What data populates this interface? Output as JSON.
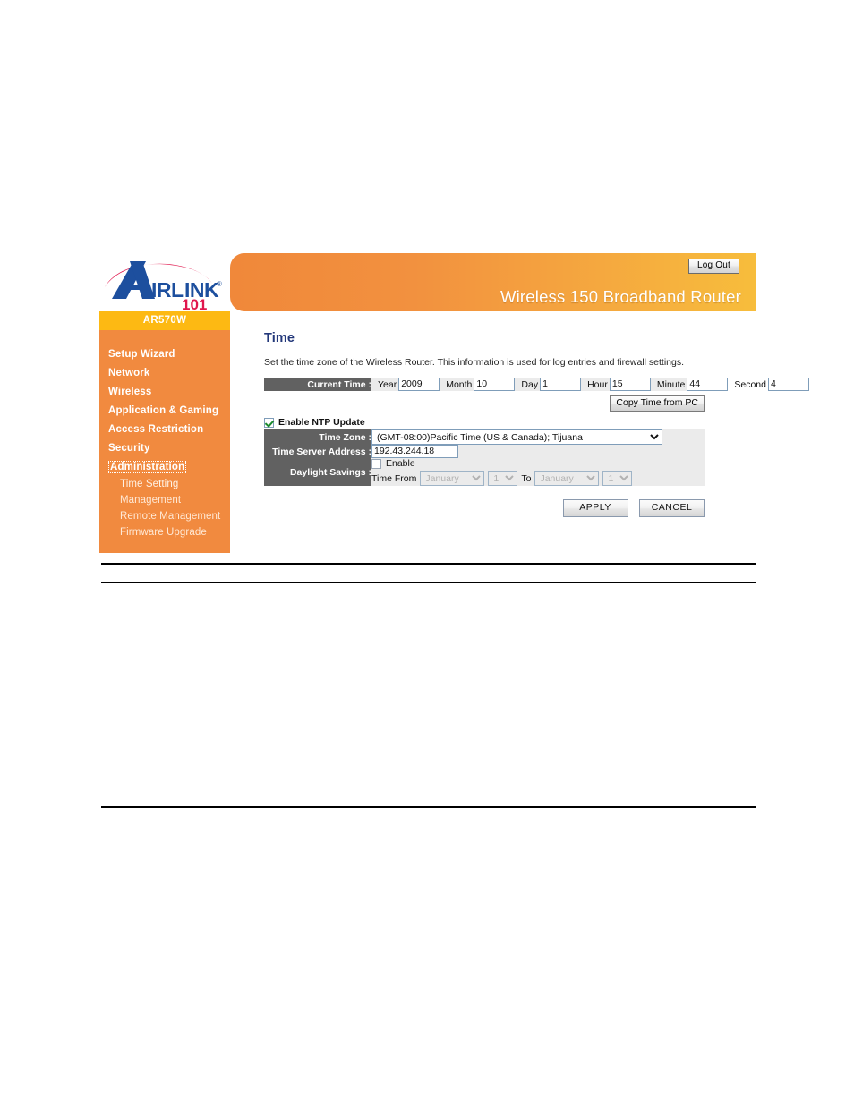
{
  "header": {
    "logo_text": "AIRLINK",
    "logo_sub": "101",
    "logo_reg": "®",
    "logout_label": "Log Out",
    "title": "Wireless 150 Broadband Router"
  },
  "sidebar": {
    "model": "AR570W",
    "items": [
      {
        "label": "Setup Wizard",
        "focused": false
      },
      {
        "label": "Network",
        "focused": false
      },
      {
        "label": "Wireless",
        "focused": false
      },
      {
        "label": "Application & Gaming",
        "focused": false
      },
      {
        "label": "Access Restriction",
        "focused": false
      },
      {
        "label": "Security",
        "focused": false
      },
      {
        "label": "Administration",
        "focused": true
      }
    ],
    "subitems": [
      {
        "label": "Time Setting",
        "active": true
      },
      {
        "label": "Management",
        "active": false
      },
      {
        "label": "Remote Management",
        "active": false
      },
      {
        "label": "Firmware Upgrade",
        "active": false
      }
    ]
  },
  "main": {
    "title": "Time",
    "description": "Set the time zone of the Wireless Router. This information is used for log entries and firewall settings.",
    "current_time": {
      "label": "Current Time :",
      "fields": [
        {
          "name": "Year",
          "value": "2009"
        },
        {
          "name": "Month",
          "value": "10"
        },
        {
          "name": "Day",
          "value": "1"
        },
        {
          "name": "Hour",
          "value": "15"
        },
        {
          "name": "Minute",
          "value": "44"
        },
        {
          "name": "Second",
          "value": "4"
        }
      ],
      "copy_button": "Copy Time from PC"
    },
    "ntp": {
      "enable_label": "Enable NTP Update",
      "enabled": true
    },
    "time_zone": {
      "label": "Time Zone :",
      "selected": "(GMT-08:00)Pacific Time (US & Canada); Tijuana"
    },
    "time_server": {
      "label": "Time Server Address :",
      "value": "192.43.244.18"
    },
    "daylight": {
      "label": "Daylight Savings :",
      "enable_label": "Enable",
      "enabled": false,
      "from_label": "Time From",
      "from_month": "January",
      "from_day": "1",
      "to_label": "To",
      "to_month": "January",
      "to_day": "1"
    },
    "buttons": {
      "apply": "APPLY",
      "cancel": "CANCEL"
    }
  },
  "colors": {
    "sidebar_bg": "#f18a3f",
    "model_bg": "#fdb913",
    "label_bg": "#616161",
    "field_bg": "#ebebeb",
    "title_color": "#23387a"
  }
}
